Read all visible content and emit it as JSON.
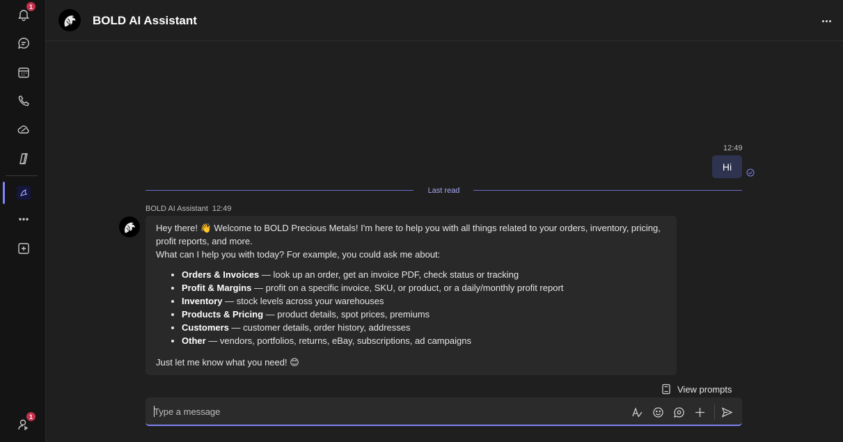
{
  "header": {
    "title": "BOLD AI Assistant"
  },
  "rail": {
    "activity_badge": "1",
    "profile_badge": "1"
  },
  "chat": {
    "sent_message": {
      "time": "12:49",
      "text": "Hi"
    },
    "last_read_label": "Last read",
    "bot_message": {
      "sender": "BOLD AI Assistant",
      "time": "12:49",
      "intro_line1": "Hey there! 👋 Welcome to BOLD Precious Metals! I'm here to help you with all things related to your orders, inventory, pricing, profit reports, and more.",
      "intro_line2": "What can I help you with today? For example, you could ask me about:",
      "items": [
        {
          "title": "Orders & Invoices",
          "desc": " — look up an order, get an invoice PDF, check status or tracking"
        },
        {
          "title": "Profit & Margins",
          "desc": " — profit on a specific invoice, SKU, or product, or a daily/monthly profit report"
        },
        {
          "title": "Inventory",
          "desc": " — stock levels across your warehouses"
        },
        {
          "title": "Products & Pricing",
          "desc": " — product details, spot prices, premiums"
        },
        {
          "title": "Customers",
          "desc": " — customer details, order history, addresses"
        },
        {
          "title": "Other",
          "desc": " — vendors, portfolios, returns, eBay, subscriptions, ad campaigns"
        }
      ],
      "outro": "Just let me know what you need! 😊"
    }
  },
  "view_prompts_label": "View prompts",
  "composer": {
    "placeholder": "Type a message"
  },
  "colors": {
    "accent": "#7f85f5",
    "badge": "#c4314b",
    "sent_bubble": "#2e3350"
  }
}
